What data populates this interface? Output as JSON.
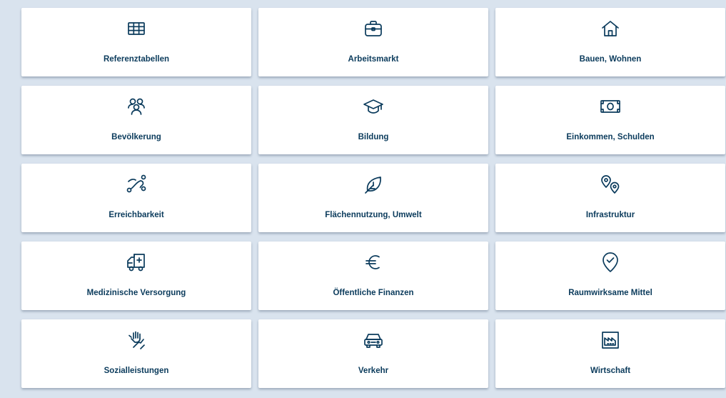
{
  "tiles": [
    {
      "label": "Referenztabellen",
      "icon": "table-icon"
    },
    {
      "label": "Arbeitsmarkt",
      "icon": "briefcase-icon"
    },
    {
      "label": "Bauen, Wohnen",
      "icon": "house-icon"
    },
    {
      "label": "Bevölkerung",
      "icon": "people-icon"
    },
    {
      "label": "Bildung",
      "icon": "graduation-cap-icon"
    },
    {
      "label": "Einkommen, Schulden",
      "icon": "banknote-icon"
    },
    {
      "label": "Erreichbarkeit",
      "icon": "route-icon"
    },
    {
      "label": "Flächennutzung, Umwelt",
      "icon": "leaf-icon"
    },
    {
      "label": "Infrastruktur",
      "icon": "map-pins-icon"
    },
    {
      "label": "Medizinische Versorgung",
      "icon": "ambulance-icon"
    },
    {
      "label": "Öffentliche Finanzen",
      "icon": "euro-icon"
    },
    {
      "label": "Raumwirksame Mittel",
      "icon": "location-check-icon"
    },
    {
      "label": "Sozialleistungen",
      "icon": "helping-hands-icon"
    },
    {
      "label": "Verkehr",
      "icon": "car-icon"
    },
    {
      "label": "Wirtschaft",
      "icon": "factory-icon"
    }
  ],
  "colors": {
    "background": "#d9e3ee",
    "tile": "#ffffff",
    "accent": "#0b3b5c"
  }
}
